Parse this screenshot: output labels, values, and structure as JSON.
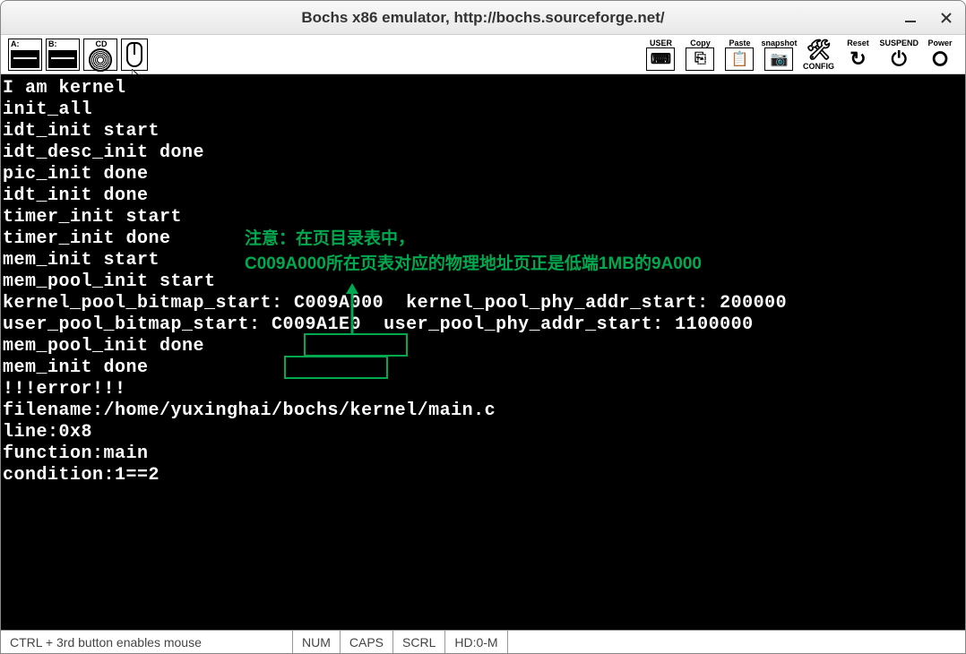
{
  "window": {
    "title": "Bochs x86 emulator, http://bochs.sourceforge.net/"
  },
  "toolbar": {
    "drives": {
      "a": "A:",
      "b": "B:",
      "cd": "CD"
    },
    "buttons": {
      "user": "USER",
      "copy": "Copy",
      "paste": "Paste",
      "snapshot": "snapshot",
      "config": "CONFIG",
      "reset": "Reset",
      "suspend": "SUSPEND",
      "power": "Power"
    }
  },
  "terminal": {
    "lines": [
      "",
      "",
      "I am kernel",
      "init_all",
      "idt_init start",
      "idt_desc_init done",
      "pic_init done",
      "idt_init done",
      "timer_init start",
      "timer_init done",
      "mem_init start",
      "mem_pool_init start",
      "kernel_pool_bitmap_start: C009A000  kernel_pool_phy_addr_start: 200000",
      "user_pool_bitmap_start: C009A1E0  user_pool_phy_addr_start: 1100000",
      "mem_pool_init done",
      "mem_init done",
      "",
      "",
      "",
      "!!!error!!!",
      "filename:/home/yuxinghai/bochs/kernel/main.c",
      "line:0x8",
      "function:main",
      "condition:1==2"
    ]
  },
  "annotation": {
    "line1": "注意：在页目录表中，",
    "line2": "C009A000所在页表对应的物理地址页正是低端1MB的9A000"
  },
  "statusbar": {
    "mouse_hint": "CTRL + 3rd button enables mouse",
    "num": "NUM",
    "caps": "CAPS",
    "scrl": "SCRL",
    "hd": "HD:0-M"
  }
}
